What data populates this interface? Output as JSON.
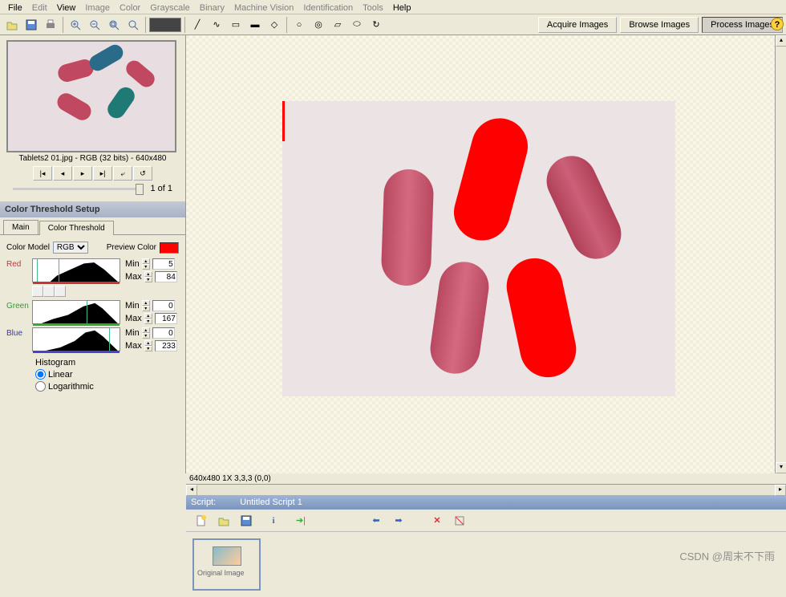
{
  "menu": {
    "items": [
      "File",
      "Edit",
      "View",
      "Image",
      "Color",
      "Grayscale",
      "Binary",
      "Machine Vision",
      "Identification",
      "Tools",
      "Help"
    ],
    "active": [
      0,
      2,
      10
    ]
  },
  "mode_buttons": {
    "acquire": "Acquire Images",
    "browse": "Browse Images",
    "process": "Process Images"
  },
  "thumbnail": {
    "caption": "Tablets2 01.jpg - RGB (32 bits) - 640x480",
    "page": "1  of  1"
  },
  "panel": {
    "title": "Color Threshold Setup",
    "tabs": {
      "main": "Main",
      "threshold": "Color Threshold"
    }
  },
  "threshold": {
    "color_model_label": "Color Model",
    "color_model_value": "RGB",
    "preview_label": "Preview Color",
    "channels": [
      {
        "name": "Red",
        "min": "5",
        "max": "84"
      },
      {
        "name": "Green",
        "min": "0",
        "max": "167"
      },
      {
        "name": "Blue",
        "min": "0",
        "max": "233"
      }
    ],
    "min_label": "Min",
    "max_label": "Max",
    "hist_label": "Histogram",
    "linear": "Linear",
    "log": "Logarithmic"
  },
  "status": "640x480 1X 3,3,3   (0,0)",
  "script": {
    "prefix": "Script:",
    "name": "Untitled Script 1",
    "thumb_label": "Original Image"
  },
  "watermark": "CSDN @周末不下雨"
}
